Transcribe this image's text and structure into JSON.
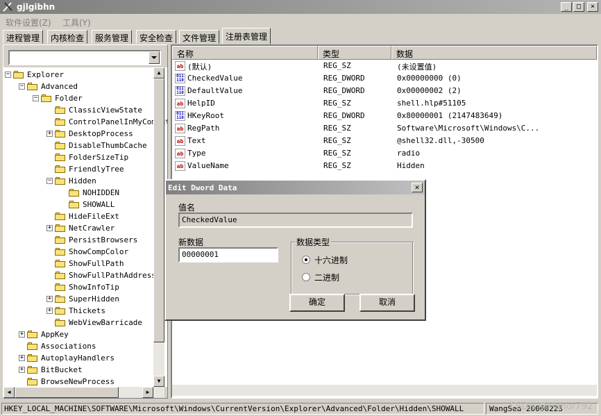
{
  "window": {
    "title": "gjlgibhn",
    "controls": [
      "_",
      "□",
      "×"
    ]
  },
  "menu": [
    "软件设置(Z)",
    "工具(Y)"
  ],
  "tabs": [
    "进程管理",
    "内核检查",
    "服务管理",
    "安全检查",
    "文件管理",
    "注册表管理"
  ],
  "active_tab": "注册表管理",
  "combo": {
    "value": ""
  },
  "tree": [
    {
      "label": "Explorer",
      "level": 0,
      "expander": "-"
    },
    {
      "label": "Advanced",
      "level": 1,
      "expander": "-"
    },
    {
      "label": "Folder",
      "level": 2,
      "expander": "-"
    },
    {
      "label": "ClassicViewState",
      "level": 3,
      "expander": ""
    },
    {
      "label": "ControlPanelInMyComputer",
      "level": 3,
      "expander": ""
    },
    {
      "label": "DesktopProcess",
      "level": 3,
      "expander": "+"
    },
    {
      "label": "DisableThumbCache",
      "level": 3,
      "expander": ""
    },
    {
      "label": "FolderSizeTip",
      "level": 3,
      "expander": ""
    },
    {
      "label": "FriendlyTree",
      "level": 3,
      "expander": ""
    },
    {
      "label": "Hidden",
      "level": 3,
      "expander": "-"
    },
    {
      "label": "NOHIDDEN",
      "level": 4,
      "expander": ""
    },
    {
      "label": "SHOWALL",
      "level": 4,
      "expander": ""
    },
    {
      "label": "HideFileExt",
      "level": 3,
      "expander": ""
    },
    {
      "label": "NetCrawler",
      "level": 3,
      "expander": "+"
    },
    {
      "label": "PersistBrowsers",
      "level": 3,
      "expander": ""
    },
    {
      "label": "ShowCompColor",
      "level": 3,
      "expander": ""
    },
    {
      "label": "ShowFullPath",
      "level": 3,
      "expander": ""
    },
    {
      "label": "ShowFullPathAddress",
      "level": 3,
      "expander": ""
    },
    {
      "label": "ShowInfoTip",
      "level": 3,
      "expander": ""
    },
    {
      "label": "SuperHidden",
      "level": 3,
      "expander": "+"
    },
    {
      "label": "Thickets",
      "level": 3,
      "expander": "+"
    },
    {
      "label": "WebViewBarricade",
      "level": 3,
      "expander": ""
    },
    {
      "label": "AppKey",
      "level": 1,
      "expander": "+"
    },
    {
      "label": "Associations",
      "level": 1,
      "expander": ""
    },
    {
      "label": "AutoplayHandlers",
      "level": 1,
      "expander": "+"
    },
    {
      "label": "BitBucket",
      "level": 1,
      "expander": "+"
    },
    {
      "label": "BrowseNewProcess",
      "level": 1,
      "expander": ""
    }
  ],
  "list": {
    "columns": [
      "名称",
      "类型",
      "数据"
    ],
    "rows": [
      {
        "icon": "string-value-icon",
        "name": "(默认)",
        "type": "REG_SZ",
        "data": "(未设置值)"
      },
      {
        "icon": "binary-value-icon",
        "name": "CheckedValue",
        "type": "REG_DWORD",
        "data": "0x00000000 (0)"
      },
      {
        "icon": "binary-value-icon",
        "name": "DefaultValue",
        "type": "REG_DWORD",
        "data": "0x00000002 (2)"
      },
      {
        "icon": "string-value-icon",
        "name": "HelpID",
        "type": "REG_SZ",
        "data": "shell.hlp#51105"
      },
      {
        "icon": "binary-value-icon",
        "name": "HKeyRoot",
        "type": "REG_DWORD",
        "data": "0x80000001 (2147483649)"
      },
      {
        "icon": "string-value-icon",
        "name": "RegPath",
        "type": "REG_SZ",
        "data": "Software\\Microsoft\\Windows\\C..."
      },
      {
        "icon": "string-value-icon",
        "name": "Text",
        "type": "REG_SZ",
        "data": "@shell32.dll,-30500"
      },
      {
        "icon": "string-value-icon",
        "name": "Type",
        "type": "REG_SZ",
        "data": "radio"
      },
      {
        "icon": "string-value-icon",
        "name": "ValueName",
        "type": "REG_SZ",
        "data": "Hidden"
      }
    ]
  },
  "dialog": {
    "title": "Edit Dword Data",
    "name_label": "值名",
    "name_value": "CheckedValue",
    "data_label": "新数据",
    "data_value": "00000001",
    "group_label": "数据类型",
    "radio_hex": "十六进制",
    "radio_bin": "二进制",
    "selected_radio": "十六进制",
    "ok": "确定",
    "cancel": "取消"
  },
  "status": {
    "path": "HKEY_LOCAL_MACHINE\\SOFTWARE\\Microsoft\\Windows\\CurrentVersion\\Explorer\\Advanced\\Folder\\Hidden\\SHOWALL",
    "author": "WangSea 20060223",
    "watermark": "CSDN @Manor792"
  }
}
